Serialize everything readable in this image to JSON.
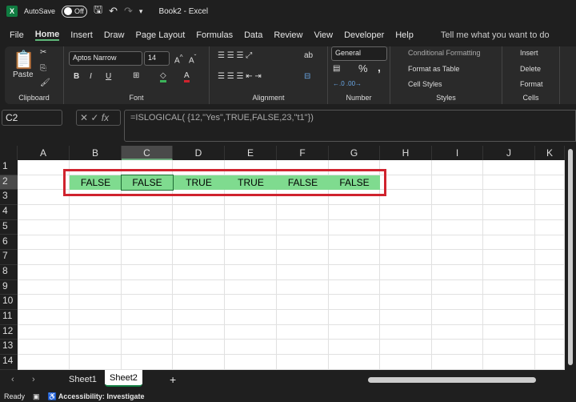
{
  "titlebar": {
    "autosave_label": "AutoSave",
    "autosave_state": "Off",
    "title": "Book2  -  Excel"
  },
  "menu": [
    "File",
    "Home",
    "Insert",
    "Draw",
    "Page Layout",
    "Formulas",
    "Data",
    "Review",
    "View",
    "Developer",
    "Help"
  ],
  "tell_me": "Tell me what you want to do",
  "ribbon": {
    "clipboard": {
      "label": "Clipboard",
      "paste": "Paste"
    },
    "font": {
      "label": "Font",
      "name": "Aptos Narrow",
      "size": "14",
      "bold": "B",
      "italic": "I",
      "underline": "U"
    },
    "alignment": {
      "label": "Alignment"
    },
    "number": {
      "label": "Number",
      "format": "General",
      "percent": "%",
      "comma": ","
    },
    "styles": {
      "label": "Styles",
      "conditional": "Conditional Formatting",
      "table": "Format as Table",
      "cell": "Cell Styles"
    },
    "cells": {
      "label": "Cells",
      "insert": "Insert",
      "delete": "Delete",
      "format": "Format"
    }
  },
  "namebox": "C2",
  "formula": "=ISLOGICAL( {12,\"Yes\",TRUE,FALSE,23,\"t1\"})",
  "columns": [
    "A",
    "B",
    "C",
    "D",
    "E",
    "F",
    "G",
    "H",
    "I",
    "J",
    "K"
  ],
  "rows": [
    "1",
    "2",
    "3",
    "4",
    "5",
    "6",
    "7",
    "8",
    "9",
    "10",
    "11",
    "12",
    "13",
    "14"
  ],
  "selected_cell": "C2",
  "row2_values": [
    "FALSE",
    "FALSE",
    "TRUE",
    "TRUE",
    "FALSE",
    "FALSE"
  ],
  "colors": {
    "cell_fill": "#7fdb8f",
    "highlight": "#d0232e",
    "accent": "#107c41"
  },
  "sheets": [
    "Sheet1",
    "Sheet2"
  ],
  "active_sheet": "Sheet2",
  "status": {
    "ready": "Ready",
    "accessibility": "Accessibility: Investigate"
  }
}
